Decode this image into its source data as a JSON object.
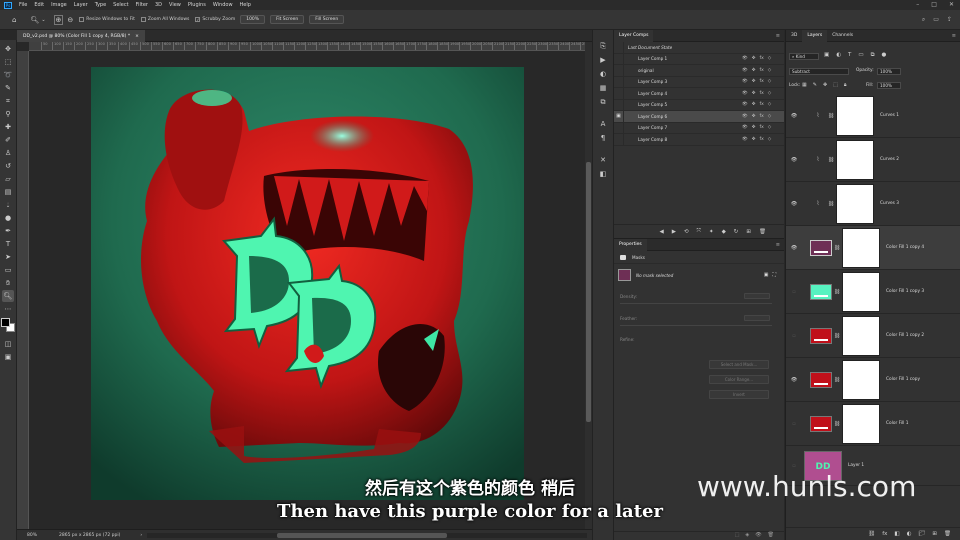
{
  "menubar": {
    "logo": "Ps",
    "items": [
      "File",
      "Edit",
      "Image",
      "Layer",
      "Type",
      "Select",
      "Filter",
      "3D",
      "View",
      "Plugins",
      "Window",
      "Help"
    ]
  },
  "options": {
    "resize_windows": "Resize Windows to Fit",
    "zoom_all": "Zoom All Windows",
    "scrubby_zoom": "Scrubby Zoom",
    "zoom_value": "100%",
    "fit_screen": "Fit Screen",
    "fill_screen": "Fill Screen"
  },
  "document": {
    "tab_title": "DD_v2.psd @ 80% (Color Fill 1 copy 4, RGB/8) *",
    "ruler_ticks": [
      "50",
      "100",
      "150",
      "200",
      "250",
      "300",
      "350",
      "400",
      "450",
      "500",
      "550",
      "600",
      "650",
      "700",
      "750",
      "800",
      "850",
      "900",
      "950",
      "1000",
      "1050",
      "1100",
      "1150",
      "1200",
      "1250",
      "1300",
      "1350",
      "1400",
      "1450",
      "1500",
      "1550",
      "1600",
      "1650",
      "1700",
      "1750",
      "1800",
      "1850",
      "1900",
      "1950",
      "2000",
      "2050",
      "2100",
      "2150",
      "2200",
      "2250",
      "2300",
      "2350",
      "2400",
      "2450",
      "2500"
    ],
    "artwork_text": "DD"
  },
  "status": {
    "zoom": "80%",
    "dimensions": "2865 px x 2865 px (72 ppi)"
  },
  "layer_comps": {
    "tab": "Layer Comps",
    "last_state": "Last Document State",
    "rows": [
      {
        "name": "Layer Comp 1"
      },
      {
        "name": "original"
      },
      {
        "name": "Layer Comp 3"
      },
      {
        "name": "Layer Comp 4"
      },
      {
        "name": "Layer Comp 5"
      },
      {
        "name": "Layer Comp 6"
      },
      {
        "name": "Layer Comp 7"
      },
      {
        "name": "Layer Comp 8"
      }
    ]
  },
  "properties": {
    "tab": "Properties",
    "masks_label": "Masks",
    "no_mask": "No mask selected",
    "density": "Density:",
    "feather": "Feather:",
    "refine": "Refine:",
    "select_mask": "Select and Mask...",
    "color_range": "Color Range...",
    "invert": "Invert"
  },
  "layers_panel": {
    "tabs": [
      "3D",
      "Layers",
      "Channels"
    ],
    "kind": "Kind",
    "blend_mode": "Subtract",
    "opacity_label": "Opacity:",
    "opacity": "100%",
    "lock_label": "Lock:",
    "fill_label": "Fill:",
    "fill": "100%",
    "layers": [
      {
        "name": "Curves 1",
        "type": "curves",
        "visible": true,
        "color": ""
      },
      {
        "name": "Curves 2",
        "type": "curves",
        "visible": true,
        "color": ""
      },
      {
        "name": "Curves 3",
        "type": "curves",
        "visible": true,
        "color": ""
      },
      {
        "name": "Color Fill 1 copy 4",
        "type": "fill",
        "visible": true,
        "color": "#6e2f55",
        "selected": true
      },
      {
        "name": "Color Fill 1 copy 3",
        "type": "fill",
        "visible": false,
        "color": "#57f2c0"
      },
      {
        "name": "Color Fill 1 copy 2",
        "type": "fill",
        "visible": false,
        "color": "#c0101a"
      },
      {
        "name": "Color Fill 1 copy",
        "type": "fill",
        "visible": true,
        "color": "#c0101a"
      },
      {
        "name": "Color Fill 1",
        "type": "fill",
        "visible": false,
        "color": "#c0101a"
      }
    ],
    "last_layer": "Layer 1"
  },
  "subtitles": {
    "cn": "然后有这个紫色的颜色 稍后",
    "en": "Then have this purple color for a later"
  },
  "watermark": "www.hunls.com",
  "colors": {
    "accent": "#31a8ff",
    "canvas_bg": "#2a7a5e",
    "art_red": "#d11a1a",
    "art_green": "#4ff5b0"
  }
}
